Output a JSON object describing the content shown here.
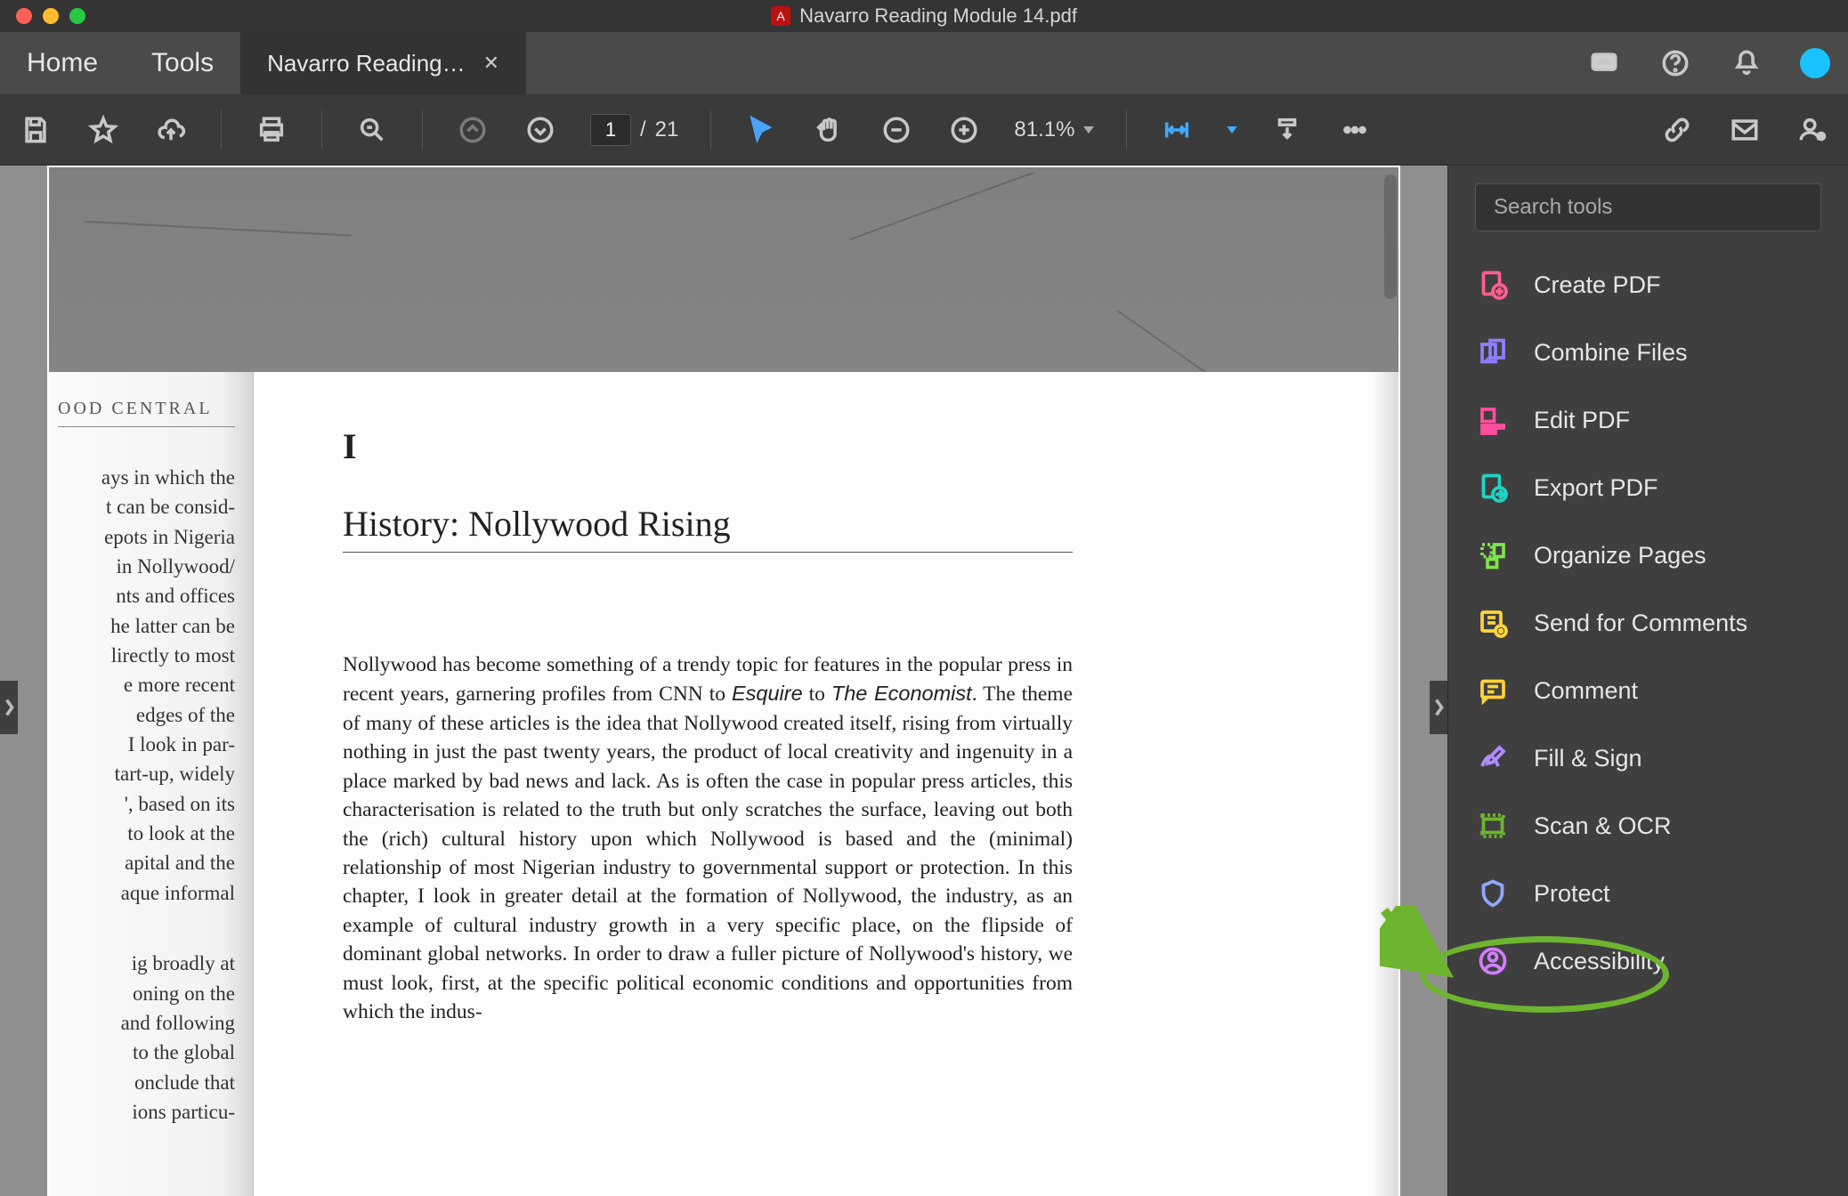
{
  "window": {
    "title": "Navarro Reading Module 14.pdf"
  },
  "tabs": {
    "home": "Home",
    "tools": "Tools",
    "doc": "Navarro Reading…"
  },
  "toolbar": {
    "current_page": "1",
    "page_sep": "/",
    "total_pages": "21",
    "zoom": "81.1%"
  },
  "document": {
    "running_head": "OOD CENTRAL",
    "left_fragment_1": "ays in which the\nt can be consid-\nepots in Nigeria\n in Nollywood/\nnts and offices\nhe latter can be\nlirectly to most\ne more recent\n edges of the\n I look in par-\ntart-up, widely\n', based on its\nto look at the\napital and the\naque informal",
    "left_fragment_2": "ig broadly at\noning on the\nand following\nto the global\nonclude that\nions particu-",
    "chapter_number": "I",
    "chapter_title": "History: Nollywood Rising",
    "body_html": "Nollywood has become something of a trendy topic for features in the popular press in recent years, garnering profiles from CNN to <em>Esquire</em> to <em>The Economist</em>. The theme of many of these articles is the idea that Nollywood created itself, rising from virtually nothing in just the past twenty years, the product of local creativity and ingenuity in a place marked by bad news and lack. As is often the case in popular press articles, this characterisation is related to the truth but only scratches the surface, leaving out both the (rich) cultural history upon which Nollywood is based and the (minimal) relationship of most Nigerian industry to governmental support or protection. In this chapter, I look in greater detail at the formation of Nollywood, the industry, as an example of cultural industry growth in a very specific place, on the flipside of dominant global networks. In order to draw a fuller picture of Nollywood's history, we must look, first, at the specific political economic conditions and opportunities from which the indus-"
  },
  "right_panel": {
    "search_placeholder": "Search tools",
    "items": [
      {
        "label": "Create PDF",
        "color": "#ff5f8f"
      },
      {
        "label": "Combine Files",
        "color": "#8f7fff"
      },
      {
        "label": "Edit PDF",
        "color": "#ff4fa0"
      },
      {
        "label": "Export PDF",
        "color": "#1fd3c6"
      },
      {
        "label": "Organize Pages",
        "color": "#7fe34d"
      },
      {
        "label": "Send for Comments",
        "color": "#ffd43b"
      },
      {
        "label": "Comment",
        "color": "#ffd43b"
      },
      {
        "label": "Fill & Sign",
        "color": "#b18cff"
      },
      {
        "label": "Scan & OCR",
        "color": "#6eb52f"
      },
      {
        "label": "Protect",
        "color": "#8fa8ff"
      },
      {
        "label": "Accessibility",
        "color": "#d07fff"
      }
    ]
  }
}
